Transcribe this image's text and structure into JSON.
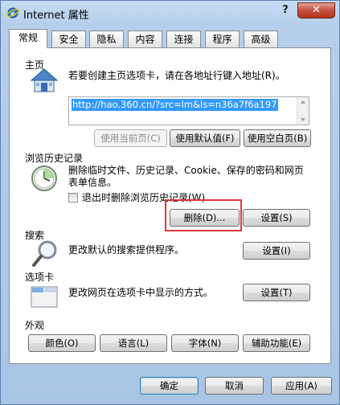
{
  "window": {
    "title": "Internet 属性",
    "help_label": "?",
    "close_label": "✕"
  },
  "tabs": [
    {
      "label": "常规",
      "active": true
    },
    {
      "label": "安全"
    },
    {
      "label": "隐私"
    },
    {
      "label": "内容"
    },
    {
      "label": "连接"
    },
    {
      "label": "程序"
    },
    {
      "label": "高级"
    }
  ],
  "homepage": {
    "section_title": "主页",
    "description": "若要创建主页选项卡，请在各地址行键入地址(R)。",
    "url_value": "http://hao.360.cn/?src=lm&ls=n36a7f6a197",
    "buttons": {
      "use_current": "使用当前页(C)",
      "use_default": "使用默认值(F)",
      "use_blank": "使用空白页(B)"
    }
  },
  "history": {
    "section_title": "浏览历史记录",
    "description_line1": "删除临时文件、历史记录、Cookie、保存的密码和网页",
    "description_line2": "表单信息。",
    "checkbox_label": "退出时删除浏览历史记录(W)",
    "delete_button": "删除(D)...",
    "settings_button": "设置(S)"
  },
  "search": {
    "section_title": "搜索",
    "description": "更改默认的搜索提供程序。",
    "settings_button": "设置(I)"
  },
  "tabs_section": {
    "section_title": "选项卡",
    "description": "更改网页在选项卡中显示的方式。",
    "settings_button": "设置(T)"
  },
  "appearance": {
    "section_title": "外观",
    "colors_button": "颜色(O)",
    "languages_button": "语言(L)",
    "fonts_button": "字体(N)",
    "accessibility_button": "辅助功能(E)"
  },
  "footer": {
    "ok_button": "确定",
    "cancel_button": "取消",
    "apply_button": "应用(A)"
  },
  "colors": {
    "accent": "#3399ff",
    "highlight_box": "#e0343a",
    "close_button": "#c4503c"
  }
}
